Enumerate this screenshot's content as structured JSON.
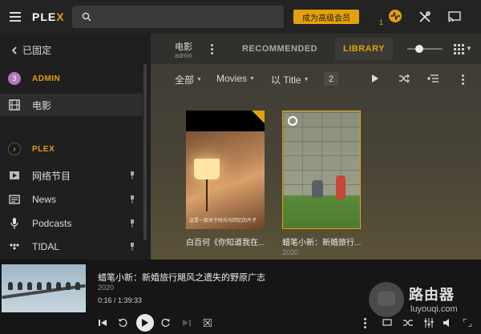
{
  "topbar": {
    "logo_main": "PLE",
    "logo_x": "X",
    "search_placeholder": "",
    "premium_label": "成为高级会员",
    "activity_count": "1",
    "icons": [
      "hamburger-icon",
      "search-icon",
      "activity-icon",
      "tools-icon",
      "cast-icon"
    ]
  },
  "sidebar": {
    "pinned_label": "已固定",
    "admin_initial": "3",
    "admin_label": "ADMIN",
    "items": [
      {
        "label": "电影",
        "icon": "film-icon",
        "active": true
      },
      {
        "label": "PLEX",
        "icon": "plex-icon"
      },
      {
        "label": "网络节目",
        "icon": "play-icon"
      },
      {
        "label": "News",
        "icon": "news-icon"
      },
      {
        "label": "Podcasts",
        "icon": "microphone-icon"
      },
      {
        "label": "TIDAL",
        "icon": "tidal-icon"
      }
    ]
  },
  "library": {
    "title": "电影",
    "subtitle": "admin",
    "tabs": [
      {
        "label": "RECOMMENDED",
        "active": false
      },
      {
        "label": "LIBRARY",
        "active": true
      }
    ],
    "filters": {
      "all": "全部",
      "type": "Movies",
      "sort": "以 Title",
      "count": "2"
    }
  },
  "posters": [
    {
      "title": "白百何《你知道我在...",
      "year": "",
      "caption": "这是一部关于时光与回忆的片子"
    },
    {
      "title": "蜡笔小新：新婚旅行...",
      "year": "2020"
    }
  ],
  "player": {
    "title": "蜡笔小新：新婚旅行飓风之遗失的野原广志",
    "year": "2020",
    "time": "0:16 / 1:39:33"
  },
  "watermark": {
    "name": "路由器",
    "domain": "luyouqi.com"
  },
  "colors": {
    "accent": "#e5a00d",
    "background": "#1f1f1f",
    "topbar": "#232323"
  }
}
